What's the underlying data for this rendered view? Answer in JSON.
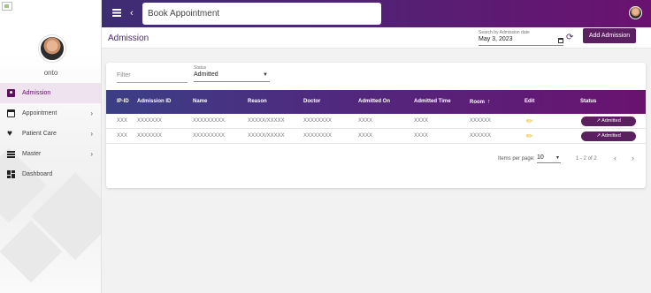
{
  "app": {
    "search_text": "Book Appointment"
  },
  "user": {
    "name": "onto"
  },
  "sidebar": {
    "items": [
      {
        "label": "Admission",
        "icon": "badge-icon",
        "active": true
      },
      {
        "label": "Appointment",
        "icon": "calendar-icon",
        "has_submenu": true
      },
      {
        "label": "Patient Care",
        "icon": "heart-icon",
        "has_submenu": true
      },
      {
        "label": "Master",
        "icon": "list-icon",
        "has_submenu": true
      },
      {
        "label": "Dashboard",
        "icon": "dashboard-icon",
        "has_submenu": false
      }
    ]
  },
  "page": {
    "title": "Admission",
    "date_label": "Search by Admission date",
    "date_value": "May 3, 2023",
    "add_button": "Add Admission"
  },
  "filters": {
    "filter_placeholder": "Filter",
    "status_label": "Status",
    "status_value": "Admitted"
  },
  "table": {
    "columns": [
      "IP-ID",
      "Admission ID",
      "Name",
      "Reason",
      "Doctor",
      "Admitted On",
      "Admitted Time",
      "Room",
      "Edit",
      "Status"
    ],
    "sorted_column": "Room",
    "rows": [
      {
        "ip_id": "XXX",
        "admission_id": "XXXXXXX",
        "name": "XXXXXXXXX",
        "reason": "XXXXX/XXXXX",
        "doctor": "XXXXXXXX",
        "admitted_on": "XXXX",
        "admitted_time": "XXXX",
        "room": "XXXXXX",
        "status": "Admitted"
      },
      {
        "ip_id": "XXX",
        "admission_id": "XXXXXXX",
        "name": "XXXXXXXXX",
        "reason": "XXXXX/XXXXX",
        "doctor": "XXXXXXXX",
        "admitted_on": "XXXX",
        "admitted_time": "XXXX",
        "room": "XXXXXX",
        "status": "Admitted"
      }
    ]
  },
  "paginator": {
    "items_per_page_label": "Items per page:",
    "items_per_page": "10",
    "range": "1 - 2 of 2"
  },
  "colors": {
    "brand_purple": "#5a2060",
    "header_gradient_start": "#3d2d73",
    "header_gradient_end": "#6a1270",
    "edit_icon": "#e6b800"
  }
}
